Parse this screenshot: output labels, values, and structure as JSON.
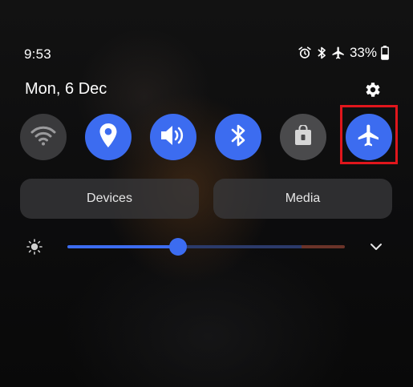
{
  "status_bar": {
    "time": "9:53",
    "icons": [
      "alarm-icon",
      "bluetooth-icon",
      "airplane-icon"
    ],
    "battery_percent": "33%"
  },
  "header": {
    "date": "Mon, 6 Dec",
    "settings_icon": "gear-icon"
  },
  "quick_settings": {
    "tiles": [
      {
        "name": "wifi",
        "icon": "wifi-icon",
        "state": "off"
      },
      {
        "name": "location",
        "icon": "location-pin-icon",
        "state": "on"
      },
      {
        "name": "sound",
        "icon": "speaker-icon",
        "state": "on"
      },
      {
        "name": "bluetooth",
        "icon": "bluetooth-icon",
        "state": "on"
      },
      {
        "name": "secure-folder",
        "icon": "lock-icon",
        "state": "off"
      },
      {
        "name": "airplane-mode",
        "icon": "airplane-icon",
        "state": "on",
        "highlighted": true
      }
    ],
    "highlight_color": "#e0161c",
    "active_color": "#3c6cf0",
    "inactive_color": "#3a3a3c"
  },
  "pills": {
    "devices_label": "Devices",
    "media_label": "Media"
  },
  "brightness": {
    "icon": "brightness-icon",
    "level": 0.4,
    "expand_icon": "chevron-down-icon"
  }
}
